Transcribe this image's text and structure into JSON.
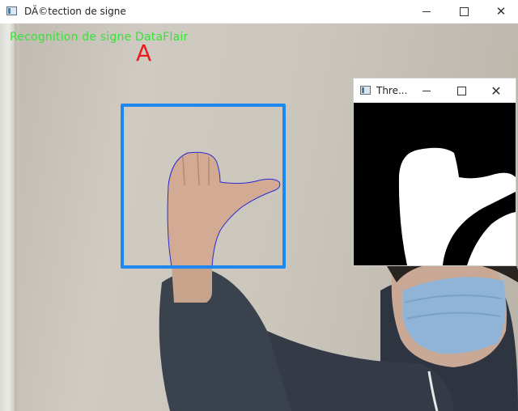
{
  "window": {
    "title": "DÃ©tection de signe",
    "minimize_icon": "minimize-icon",
    "maximize_icon": "maximize-icon",
    "close_icon": "close-icon"
  },
  "feed": {
    "overlay_title": "Recognition de signe DataFlair",
    "predicted_letter": "A",
    "colors": {
      "overlay_title": "#39e03a",
      "predicted_letter": "#ea1c1c",
      "roi_box": "#1e88f0"
    }
  },
  "threshold_window": {
    "title": "Thre..."
  }
}
